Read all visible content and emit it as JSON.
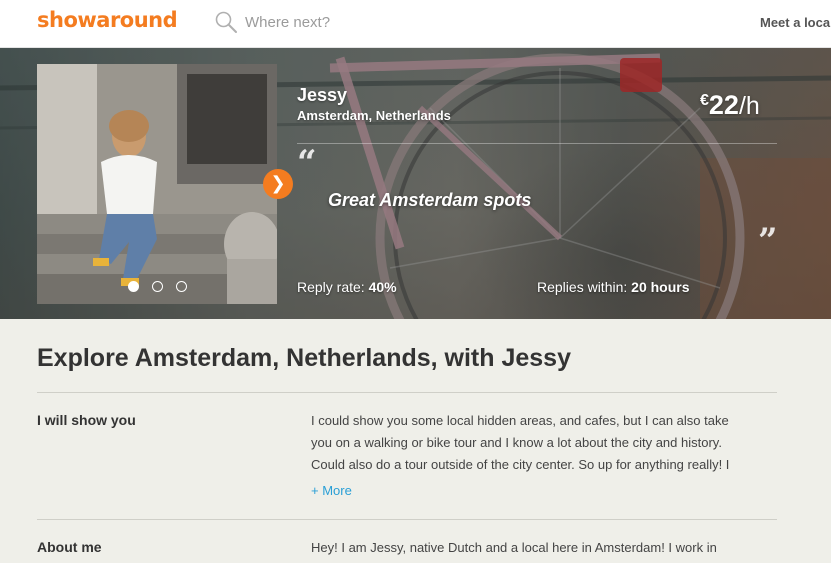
{
  "header": {
    "logo": "showaround",
    "search_placeholder": "Where next?",
    "meet_local": "Meet a loca"
  },
  "hero": {
    "name": "Jessy",
    "location": "Amsterdam, Netherlands",
    "price": {
      "currency": "€",
      "amount": "22",
      "unit": "/h"
    },
    "tagline": "Great Amsterdam spots",
    "reply_rate_label": "Reply rate:",
    "reply_rate_value": "40%",
    "replies_within_label": "Replies within:",
    "replies_within_value": "20 hours",
    "carousel": {
      "total": 3,
      "active": 1
    }
  },
  "content": {
    "title": "Explore Amsterdam, Netherlands, with Jessy",
    "sections": [
      {
        "label": "I will show you",
        "lines": [
          "I could show you some local hidden areas, and cafes, but I can also take",
          "you on a walking or bike tour and I know a lot about the city and history.",
          "Could also do a tour outside of the city center. So up for anything really! I"
        ],
        "more": "+ More"
      },
      {
        "label": "About me",
        "lines": [
          "Hey! I am Jessy, native Dutch and a local here in Amsterdam! I work in"
        ]
      }
    ]
  },
  "colors": {
    "brand": "#f47c20",
    "link": "#2a9fd6",
    "background": "#efefe9"
  },
  "icons": [
    "search-icon",
    "chevron-right-icon",
    "quote-open-icon",
    "quote-close-icon"
  ]
}
